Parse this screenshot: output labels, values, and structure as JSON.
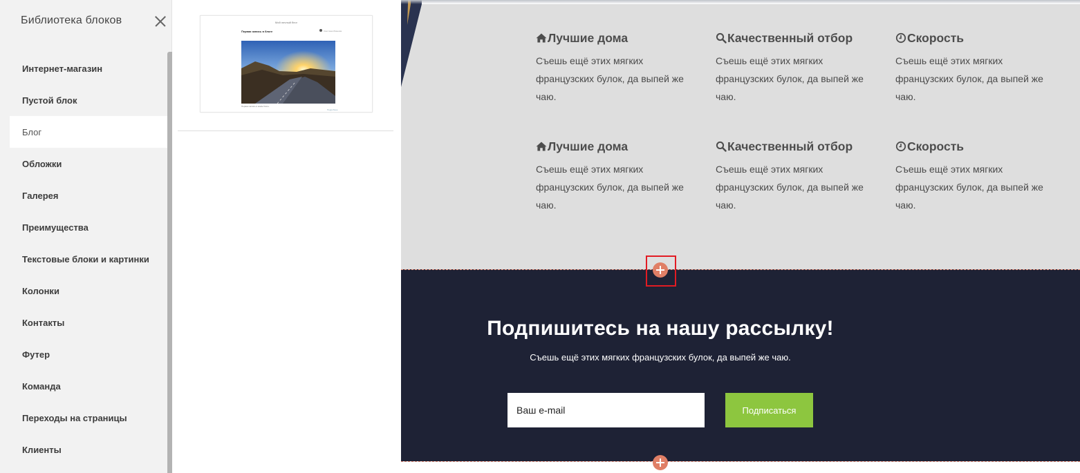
{
  "sidebar": {
    "title": "Библиотека блоков",
    "close_icon": "close-icon",
    "categories": [
      {
        "label": "Интернет-магазин",
        "active": false
      },
      {
        "label": "Пустой блок",
        "active": false
      },
      {
        "label": "Блог",
        "active": true
      },
      {
        "label": "Обложки",
        "active": false
      },
      {
        "label": "Галерея",
        "active": false
      },
      {
        "label": "Преимущества",
        "active": false
      },
      {
        "label": "Текстовые блоки и картинки",
        "active": false
      },
      {
        "label": "Колонки",
        "active": false
      },
      {
        "label": "Контакты",
        "active": false
      },
      {
        "label": "Футер",
        "active": false
      },
      {
        "label": "Команда",
        "active": false
      },
      {
        "label": "Переходы на страницы",
        "active": false
      },
      {
        "label": "Клиенты",
        "active": false
      }
    ]
  },
  "preview": {
    "blog_title": "Мой личный блог",
    "post_title": "Первая запись в блоге",
    "author": "Светлана Иванова",
    "caption": "Первая запись в моём блоге.",
    "more_link": "Подробнее"
  },
  "features": {
    "items": [
      {
        "icon": "home-icon",
        "title": "Лучшие дома",
        "text": "Съешь ещё этих мягких французских булок, да выпей же чаю."
      },
      {
        "icon": "search-icon",
        "title": "Качественный отбор",
        "text": "Съешь ещё этих мягких французских булок, да выпей же чаю."
      },
      {
        "icon": "clock-icon",
        "title": "Скорость",
        "text": "Съешь ещё этих мягких французских булок, да выпей же чаю."
      },
      {
        "icon": "home-icon",
        "title": "Лучшие дома",
        "text": "Съешь ещё этих мягких французских булок, да выпей же чаю."
      },
      {
        "icon": "search-icon",
        "title": "Качественный отбор",
        "text": "Съешь ещё этих мягких французских булок, да выпей же чаю."
      },
      {
        "icon": "clock-icon",
        "title": "Скорость",
        "text": "Съешь ещё этих мягких французских булок, да выпей же чаю."
      }
    ]
  },
  "subscribe": {
    "title": "Подпишитесь на нашу рассылку!",
    "subtitle": "Съешь ещё этих мягких французских булок, да выпей же чаю.",
    "email_placeholder": "Ваш e-mail",
    "button_label": "Подписаться"
  },
  "editor": {
    "add_block_icon": "plus-icon"
  },
  "colors": {
    "features_bg": "#dedede",
    "subscribe_bg": "#1e2235",
    "subscribe_button": "#8dc63f",
    "add_button": "#e07f66",
    "highlight": "#e21b23"
  }
}
